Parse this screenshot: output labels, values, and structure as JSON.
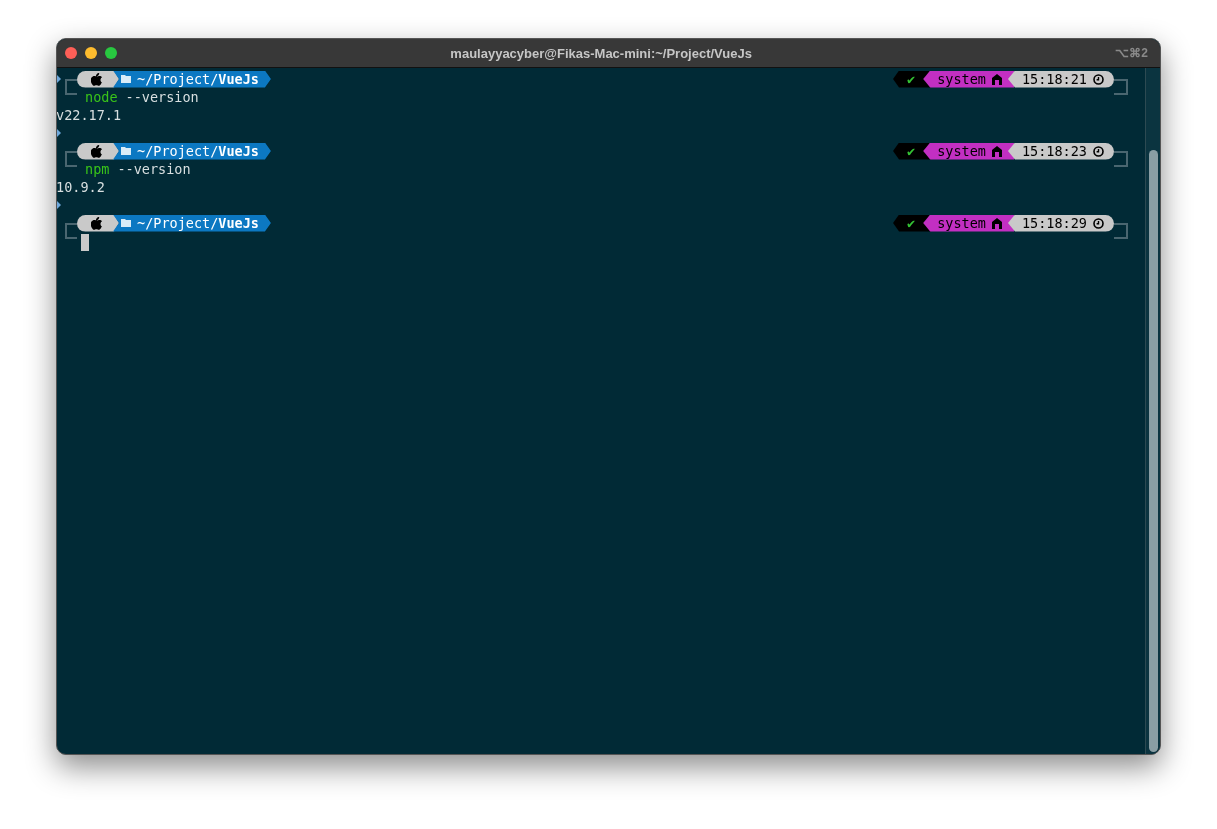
{
  "window": {
    "title": "maulayyacyber@Fikas-Mac-mini:~/Project/VueJs",
    "shortcut": "⌥⌘2"
  },
  "blocks": [
    {
      "path": "~/Project/**VueJs**",
      "status": "✔",
      "env": "system",
      "time": "15:18:21",
      "command": "node",
      "args": "--version",
      "output": "v22.17.1"
    },
    {
      "path": "~/Project/**VueJs**",
      "status": "✔",
      "env": "system",
      "time": "15:18:23",
      "command": "npm",
      "args": "--version",
      "output": "10.9.2"
    },
    {
      "path": "~/Project/**VueJs**",
      "status": "✔",
      "env": "system",
      "time": "15:18:29",
      "cursor": true
    }
  ]
}
